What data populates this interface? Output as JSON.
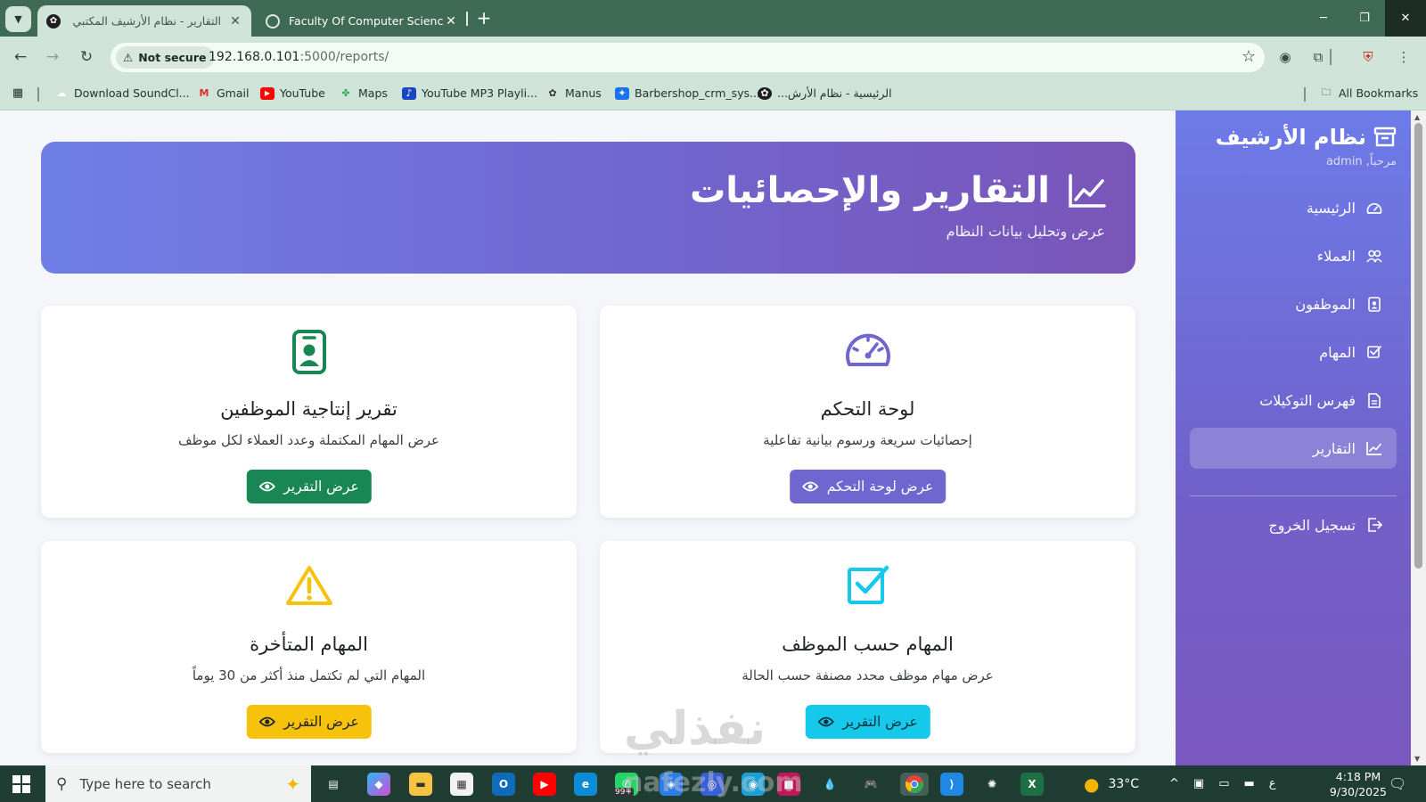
{
  "browser": {
    "tabs": [
      {
        "title": "التقارير - نظام الأرشيف المكتبي",
        "active": true
      },
      {
        "title": "Faculty Of Computer Science an",
        "active": false
      }
    ],
    "not_secure": "Not secure",
    "url_host": "192.168.0.101",
    "url_path": ":5000/reports/",
    "bookmarks": [
      {
        "label": "Download SoundCl...",
        "icon": "cloud-icon",
        "color": "#ffffff"
      },
      {
        "label": "Gmail",
        "icon": "gmail-icon",
        "color": "#d93025"
      },
      {
        "label": "YouTube",
        "icon": "youtube-icon",
        "color": "#ff0000"
      },
      {
        "label": "Maps",
        "icon": "maps-icon",
        "color": "#34a853"
      },
      {
        "label": "YouTube MP3 Playli...",
        "icon": "music-icon",
        "color": "#1a46c6"
      },
      {
        "label": "Manus",
        "icon": "manus-icon",
        "color": "#333333"
      },
      {
        "label": "Barbershop_crm_sys...",
        "icon": "app-icon",
        "color": "#1a73e8"
      },
      {
        "label": "الرئيسية - نظام الأرش...",
        "icon": "archive-icon",
        "color": "#1f1f1f"
      }
    ],
    "all_bookmarks": "All Bookmarks"
  },
  "sidebar": {
    "title": "نظام الأرشيف",
    "welcome": "مرحباً, admin",
    "items": [
      {
        "label": "الرئيسية",
        "icon": "speedometer-icon",
        "active": false
      },
      {
        "label": "العملاء",
        "icon": "people-icon",
        "active": false
      },
      {
        "label": "الموظفون",
        "icon": "badge-icon",
        "active": false
      },
      {
        "label": "المهام",
        "icon": "check-square-icon",
        "active": false
      },
      {
        "label": "فهرس التوكيلات",
        "icon": "document-icon",
        "active": false
      },
      {
        "label": "التقارير",
        "icon": "chart-line-icon",
        "active": true
      }
    ],
    "logout": "تسجيل الخروج"
  },
  "hero": {
    "title": "التقارير والإحصائيات",
    "subtitle": "عرض وتحليل بيانات النظام"
  },
  "cards": [
    {
      "id": "dashboard",
      "title": "لوحة التحكم",
      "desc": "إحصائيات سريعة ورسوم بيانية تفاعلية",
      "button": "عرض لوحة التحكم",
      "icon": "speedometer-icon",
      "color": "#6f66cf"
    },
    {
      "id": "productivity",
      "title": "تقرير إنتاجية الموظفين",
      "desc": "عرض المهام المكتملة وعدد العملاء لكل موظف",
      "button": "عرض التقرير",
      "icon": "person-badge-icon",
      "color": "#198754"
    },
    {
      "id": "by-employee",
      "title": "المهام حسب الموظف",
      "desc": "عرض مهام موظف محدد مصنفة حسب الحالة",
      "button": "عرض التقرير",
      "icon": "check-square-icon",
      "color": "#16c8ea"
    },
    {
      "id": "overdue",
      "title": "المهام المتأخرة",
      "desc": "المهام التي لم تكتمل منذ أكثر من 30 يوماً",
      "button": "عرض التقرير",
      "icon": "warning-icon",
      "color": "#f7c20c"
    }
  ],
  "watermark": "نفذلي",
  "taskbar": {
    "search_placeholder": "Type here to search",
    "badge": "99+",
    "watermark_url": "nafezly.com",
    "weather": "33°C",
    "lang": "ع",
    "time": "4:18 PM",
    "date": "9/30/2025"
  }
}
